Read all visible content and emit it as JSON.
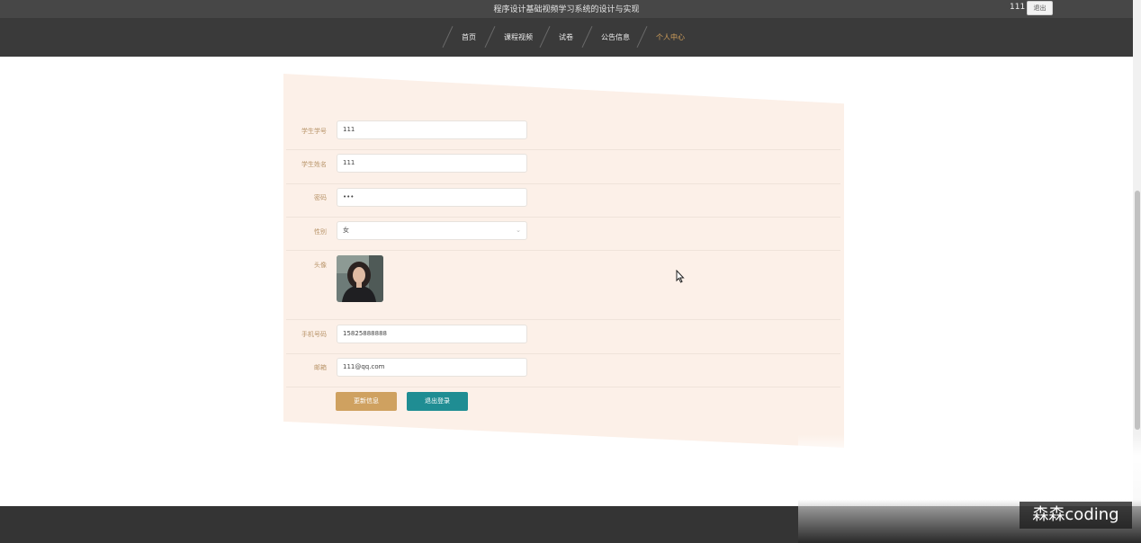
{
  "header": {
    "site_title": "程序设计基础视频学习系统的设计与实现",
    "user_name": "111",
    "logout_label": "退出"
  },
  "nav": {
    "items": [
      {
        "label": "首页"
      },
      {
        "label": "课程视频"
      },
      {
        "label": "试卷"
      },
      {
        "label": "公告信息"
      },
      {
        "label": "个人中心"
      }
    ]
  },
  "form": {
    "student_id": {
      "label": "学生学号",
      "value": "111"
    },
    "student_name": {
      "label": "学生姓名",
      "value": "111"
    },
    "password": {
      "label": "密码",
      "value": "•••"
    },
    "gender": {
      "label": "性别",
      "value": "女"
    },
    "avatar": {
      "label": "头像"
    },
    "phone": {
      "label": "手机号码",
      "value": "15825888888"
    },
    "email": {
      "label": "邮箱",
      "value": "111@qq.com"
    },
    "update_button": "更新信息",
    "logout_button": "退出登录"
  },
  "watermark": "森森coding"
}
